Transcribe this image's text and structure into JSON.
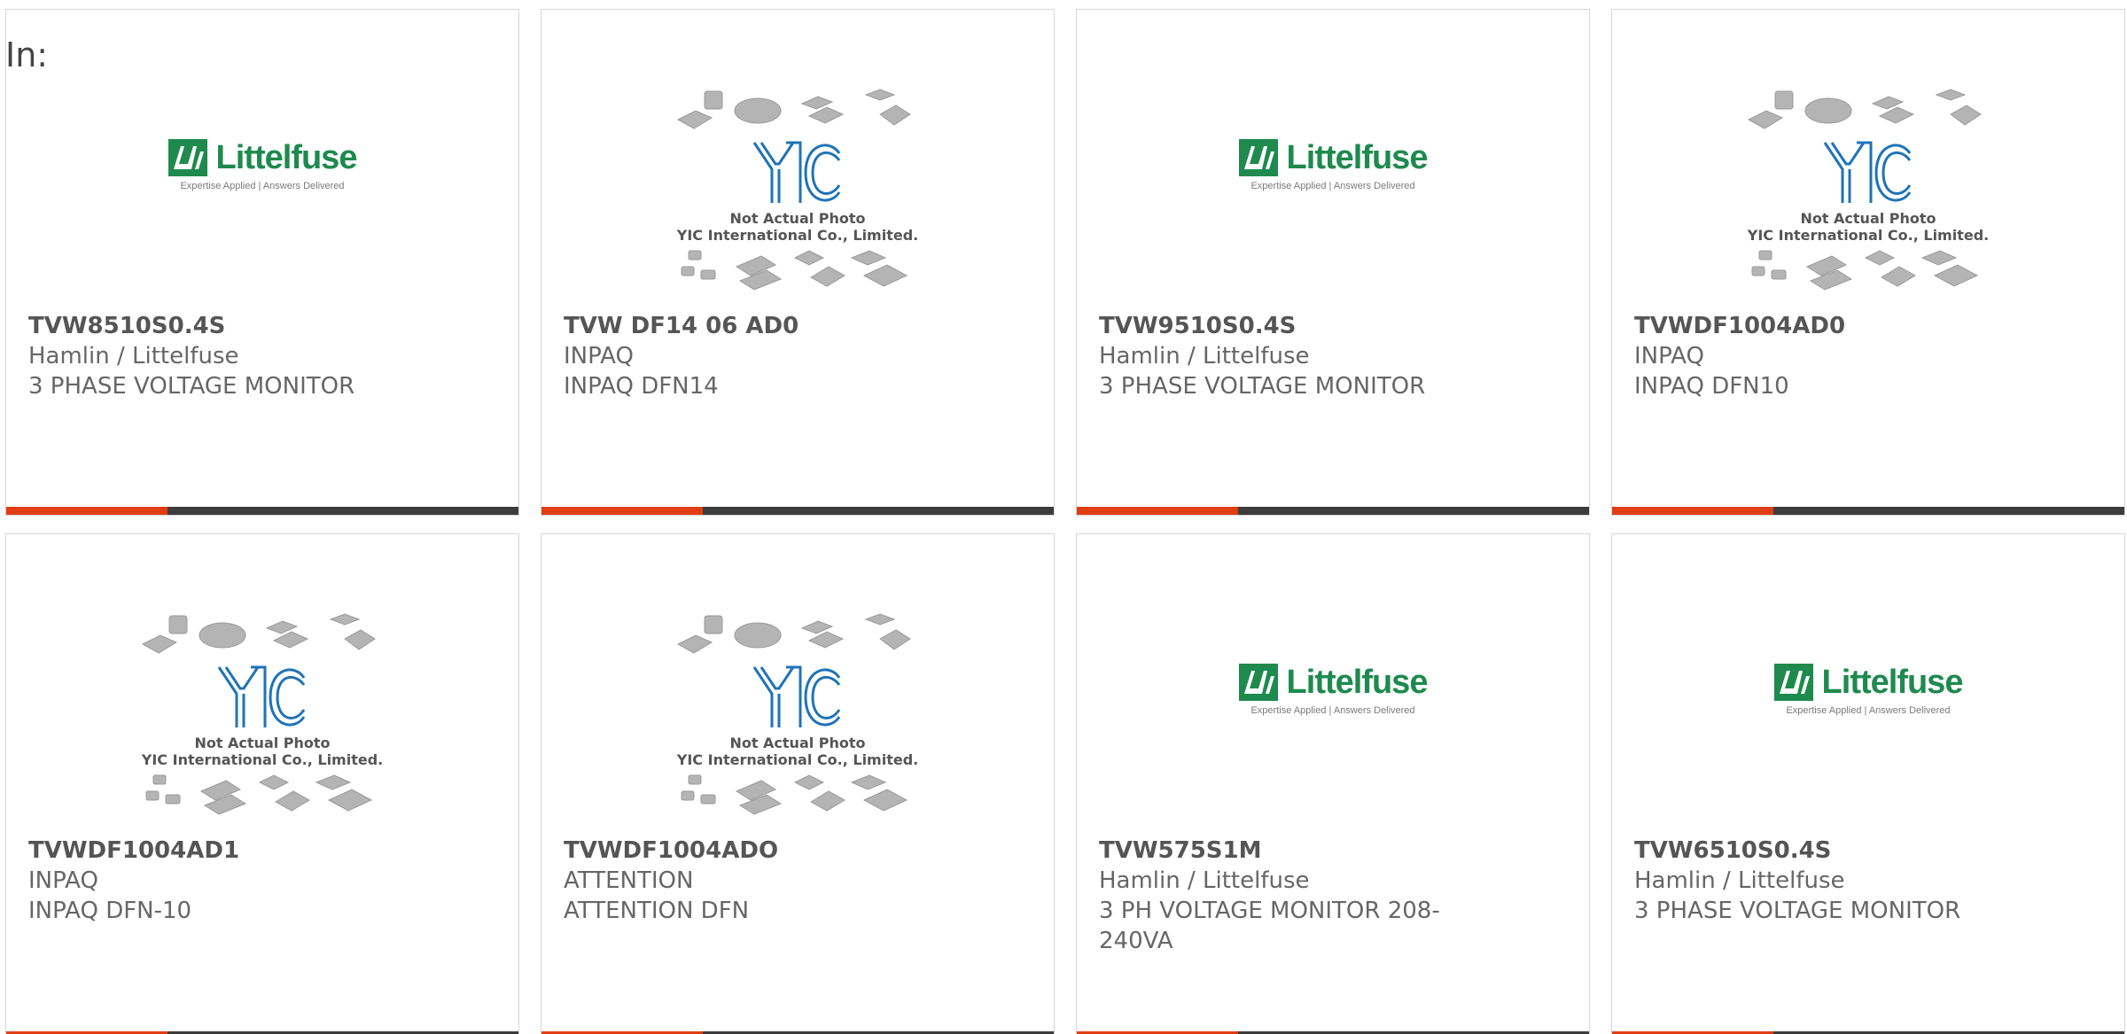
{
  "search": {
    "label": "In:"
  },
  "placeholder": {
    "line1": "Not Actual Photo",
    "line2": "YIC International Co., Limited.",
    "logo_text": "YIC"
  },
  "littelfuse": {
    "wordmark": "Littelfuse",
    "tagline": "Expertise Applied | Answers Delivered"
  },
  "colors": {
    "accent": "#e03e12",
    "bar": "#3c3c3c",
    "littelfuse_green": "#1e8a4e",
    "yic_blue": "#1f73b7"
  },
  "products": [
    {
      "part_number": "TVW8510S0.4S",
      "manufacturer": "Hamlin / Littelfuse",
      "description": "3 PHASE VOLTAGE MONITOR",
      "image": "littelfuse-logo"
    },
    {
      "part_number": "TVW DF14 06 AD0",
      "manufacturer": "INPAQ",
      "description": "INPAQ DFN14",
      "image": "yic-placeholder"
    },
    {
      "part_number": "TVW9510S0.4S",
      "manufacturer": "Hamlin / Littelfuse",
      "description": "3 PHASE VOLTAGE MONITOR",
      "image": "littelfuse-logo"
    },
    {
      "part_number": "TVWDF1004AD0",
      "manufacturer": "INPAQ",
      "description": "INPAQ DFN10",
      "image": "yic-placeholder"
    },
    {
      "part_number": "TVWDF1004AD1",
      "manufacturer": "INPAQ",
      "description": "INPAQ DFN-10",
      "image": "yic-placeholder"
    },
    {
      "part_number": "TVWDF1004ADO",
      "manufacturer": "ATTENTION",
      "description": "ATTENTION DFN",
      "image": "yic-placeholder"
    },
    {
      "part_number": "TVW575S1M",
      "manufacturer": "Hamlin / Littelfuse",
      "description": "3 PH VOLTAGE MONITOR 208-240VA",
      "image": "littelfuse-logo"
    },
    {
      "part_number": "TVW6510S0.4S",
      "manufacturer": "Hamlin / Littelfuse",
      "description": "3 PHASE VOLTAGE MONITOR",
      "image": "littelfuse-logo"
    }
  ]
}
